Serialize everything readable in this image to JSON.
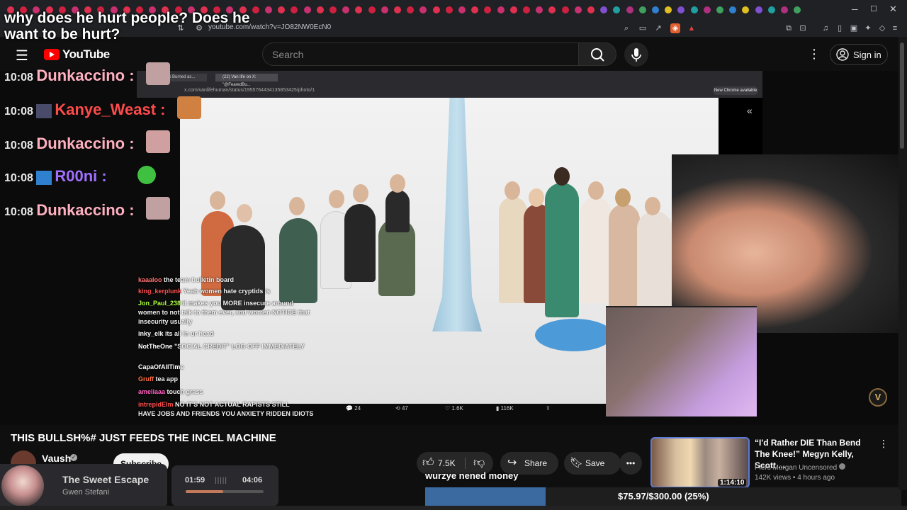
{
  "browser": {
    "url": "youtube.com/watch?v=JO82NW0EcN0"
  },
  "caption": {
    "text": "why does he hurt people? Does he want to be hurt?"
  },
  "header": {
    "logo_text": "YouTube",
    "search_placeholder": "Search",
    "sign_in_label": "Sign in"
  },
  "chat_overlay": [
    {
      "time": "10:08",
      "user": "Dunkaccino",
      "color": "#ffb0c0"
    },
    {
      "time": "10:08",
      "user": "Kanye_Weast",
      "color": "#ff4a4a"
    },
    {
      "time": "10:08",
      "user": "Dunkaccino",
      "color": "#ffb0c0"
    },
    {
      "time": "10:08",
      "user": "R00ni",
      "color": "#a070ff"
    },
    {
      "time": "10:08",
      "user": "Dunkaccino",
      "color": "#ffb0c0"
    }
  ],
  "inner_browser": {
    "url": "x.com/vanlifehuman/status/1955764434135853425/photo/1",
    "tab1": "Hopes Burned as...",
    "tab2": "(22) Van life on X: \"@FearedBu...",
    "new_chrome_label": "New Chrome available"
  },
  "tweet_stats": {
    "replies": "24",
    "reposts": "47",
    "likes": "1.6K",
    "views": "116K"
  },
  "stream_chat": [
    {
      "user": "kaaaloo",
      "msg": "the team bulletin board",
      "color": "#ff7070"
    },
    {
      "user": "king_kerplunk",
      "msg": "Yeah women hate cryptids /s",
      "color": "#ff5050"
    },
    {
      "user": "Jon_Paul_238",
      "msg": "it makes you MORE insecure around",
      "color": "#b0ff40"
    },
    {
      "user": "",
      "msg": "women to not talk to them ever, and women NOTICE that",
      "color": "#fff"
    },
    {
      "user": "",
      "msg": "insecurity usually",
      "color": "#fff"
    },
    {
      "user": "inky_elk",
      "msg": "its all in ur head",
      "color": "#fff"
    },
    {
      "user": "NotTheOne",
      "msg": "\"SOCIAL CREDIT\" LOG OFF IMMEDIATELY",
      "color": "#fff"
    },
    {
      "user": "CapaOfAllTime",
      "msg": "",
      "color": "#fff"
    },
    {
      "user": "Gruff",
      "msg": "tea app",
      "color": "#ff7040"
    },
    {
      "user": "ameliaaa",
      "msg": "touch grass",
      "color": "#ff60c0"
    },
    {
      "user": "intrepidElm",
      "msg": "NO IT'S NOT ACTUAL RAPISTS STILL",
      "color": "#ff5050"
    },
    {
      "user": "",
      "msg": "HAVE JOBS AND FRIENDS YOU ANXIETY RIDDEN IDIOTS",
      "color": "#fff"
    }
  ],
  "video": {
    "title": "THIS BULLSH%# JUST FEEDS THE INCEL MACHINE",
    "channel": "Vaush",
    "subscribe_label": "Subscribe",
    "likes": "7.5K",
    "share_label": "Share",
    "save_label": "Save"
  },
  "recommended": {
    "title": "“I'd Rather DIE Than Bend The Knee!” Megyn Kelly, Scott ...",
    "channel": "Piers Morgan Uncensored",
    "meta": "142K views • 4 hours ago",
    "duration": "1:14:10"
  },
  "music": {
    "song": "The Sweet Escape",
    "artist": "Gwen Stefani",
    "current": "01:59",
    "total": "04:06",
    "progress": 0.48
  },
  "donation": {
    "message": "wurzye nened money",
    "goal_text": "$75.97/$300.00 (25%)",
    "progress": 0.253
  },
  "icons": {
    "menu": "hamburger-icon",
    "search": "search-icon",
    "mic": "mic-icon",
    "more": "kebab-icon",
    "user": "account-icon",
    "like": "thumbs-up-icon",
    "dislike": "thumbs-down-icon",
    "share": "share-icon",
    "save": "bookmark-icon"
  },
  "colors": {
    "yt_red": "#ff0000",
    "background": "#0f0f0f",
    "pill": "#272727",
    "goal_fill": "#3b6aa0"
  }
}
